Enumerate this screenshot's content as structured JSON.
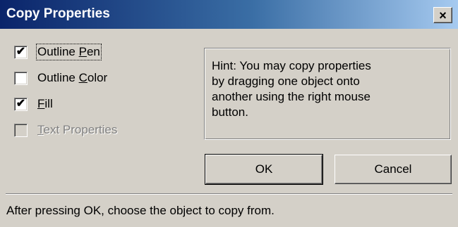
{
  "window": {
    "title": "Copy Properties",
    "close_glyph": "×"
  },
  "checkboxes": [
    {
      "label_pre": "Outline ",
      "label_u": "P",
      "label_post": "en",
      "checked": true,
      "check_glyph": "✔",
      "enabled": true,
      "focused": true
    },
    {
      "label_pre": "Outline ",
      "label_u": "C",
      "label_post": "olor",
      "checked": false,
      "check_glyph": "",
      "enabled": true,
      "focused": false
    },
    {
      "label_pre": "",
      "label_u": "F",
      "label_post": "ill",
      "checked": true,
      "check_glyph": "✔",
      "enabled": true,
      "focused": false
    },
    {
      "label_pre": "",
      "label_u": "T",
      "label_post": "ext Properties",
      "checked": false,
      "check_glyph": "",
      "enabled": false,
      "focused": false
    }
  ],
  "hint": {
    "line1": "Hint: You may copy properties",
    "line2": "by dragging one object onto",
    "line3": "another using the right mouse",
    "line4": "button."
  },
  "buttons": {
    "ok": "OK",
    "cancel": "Cancel"
  },
  "status_text": "After pressing OK, choose the object to copy from.",
  "colors": {
    "titlebar_start": "#0a246a",
    "titlebar_end": "#a6caf0",
    "dialog_bg": "#d4d0c8"
  }
}
